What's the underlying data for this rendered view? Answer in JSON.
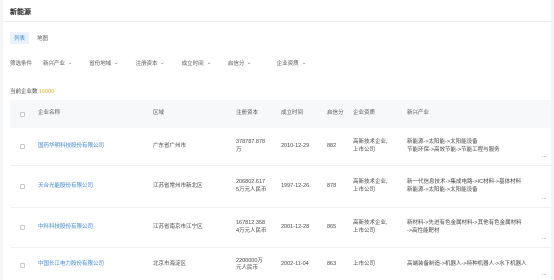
{
  "title": "新能源",
  "views": {
    "list": "列表",
    "map": "地图"
  },
  "filters": {
    "label": "筛选条件",
    "items": [
      "新兴产业",
      "省份地域",
      "注册资本",
      "成立时间",
      "启信分",
      "企业资质"
    ]
  },
  "count": {
    "prefix": "当前企业数",
    "value": "16000"
  },
  "table": {
    "headers": [
      "企业名称",
      "区域",
      "注册资本",
      "成立时间",
      "启信分",
      "企业资质",
      "新兴产业"
    ],
    "rows": [
      {
        "name": "国药华明科技股份有限公司",
        "region": "广东省广州市",
        "capital": [
          "378787.878",
          "万"
        ],
        "date": "2010-12-29",
        "score": "882",
        "qual": [
          "高新技术企业,",
          "上市公司"
        ],
        "industry": [
          "新能源->太阳能->太阳能设备",
          "节能环保->高效节能->节能工程与服务"
        ],
        "more": "..."
      },
      {
        "name": "天合光能股份有限公司",
        "region": "江苏省常州市新北区",
        "capital": [
          "206802.617",
          "5万元人民币"
        ],
        "date": "1997-12-26",
        "score": "878",
        "qual": [
          "高新技术企业,",
          "上市公司"
        ],
        "industry": [
          "新一代信息技术->集成电路->IC材料->基体材料",
          "新能源->太阳能->太阳能设备"
        ],
        "more": "..."
      },
      {
        "name": "中科科技股份有限公司",
        "region": "江苏省南京市江宁区",
        "capital": [
          "167812.358",
          "4万元人民币"
        ],
        "date": "2001-12-28",
        "score": "865",
        "qual": [
          "高新技术企业,",
          "上市公司"
        ],
        "industry": [
          "新材料->先进有色金属材料->其他有色金属材料",
          "->高性能靶材"
        ],
        "more": "..."
      },
      {
        "name": "中国长江电力股份有限公司",
        "region": "北京市海淀区",
        "capital": [
          "2200000万",
          "元人民币"
        ],
        "date": "2002-11-04",
        "score": "863",
        "qual": [
          "上市公司"
        ],
        "industry": [
          "高端装备制造->机器人->特种机器人->水下机器人"
        ],
        "more": "..."
      }
    ]
  }
}
